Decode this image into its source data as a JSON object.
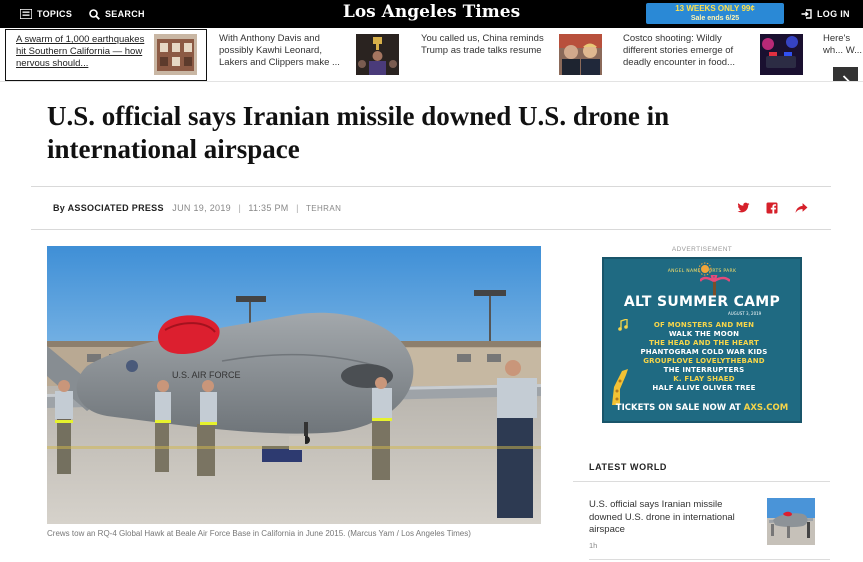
{
  "topbar": {
    "topics_label": "TOPICS",
    "search_label": "SEARCH",
    "logo_text": "Los Angeles Times",
    "promo_line1": "13 WEEKS ONLY 99¢",
    "promo_line2": "Sale ends 6/25",
    "login_label": "LOG IN",
    "background_color": "#000000",
    "promo_color": "#2a89d6"
  },
  "strip": {
    "items": [
      {
        "text": "A swarm of 1,000 earthquakes hit Southern California — how nervous should...",
        "icon": "building-photo"
      },
      {
        "text": "With Anthony Davis and possibly Kawhi Leonard, Lakers and Clippers make ...",
        "icon": "trophy-photo"
      },
      {
        "text": "You called us, China reminds Trump as trade talks resume",
        "icon": "leaders-photo"
      },
      {
        "text": "Costco shooting: Wildly different stories emerge of deadly encounter in food...",
        "icon": "police-lights-photo"
      },
      {
        "text": "Here's wh... W...",
        "icon": ""
      }
    ]
  },
  "article": {
    "headline": "U.S. official says Iranian missile downed U.S. drone in international airspace",
    "byline_prefix": "By",
    "author": "ASSOCIATED PRESS",
    "date": "JUN 19, 2019",
    "time": "11:35 PM",
    "location": "TEHRAN",
    "caption": "Crews tow an RQ-4 Global Hawk at Beale Air Force Base in California in June 2015. (Marcus Yam / Los Angeles Times)",
    "share_color": "#d6202a",
    "image_text": "U.S. AIR FORCE"
  },
  "sidebar": {
    "ad_label": "ADVERTISEMENT",
    "ad": {
      "venue": "ANGEL NAME SPORTS PARK",
      "title": "ALT SUMMER CAMP",
      "date": "AUGUST 3, 2019",
      "lineup": [
        "OF MONSTERS AND MEN",
        "WALK THE MOON",
        "THE HEAD AND THE HEART",
        "PHANTOGRAM  COLD WAR KIDS",
        "GROUPLOVE  LOVELYTHEBAND",
        "THE INTERRUPTERS",
        "K. FLAY  SHAED",
        "HALF ALIVE  OLIVER TREE"
      ],
      "tickets_prefix": "TICKETS ON SALE NOW AT",
      "tickets_site": "AXS.COM",
      "bg_color": "#1f6a82"
    },
    "latest_heading": "LATEST WORLD",
    "latest_item": {
      "title": "U.S. official says Iranian missile downed U.S. drone in international airspace",
      "age": "1h"
    }
  }
}
